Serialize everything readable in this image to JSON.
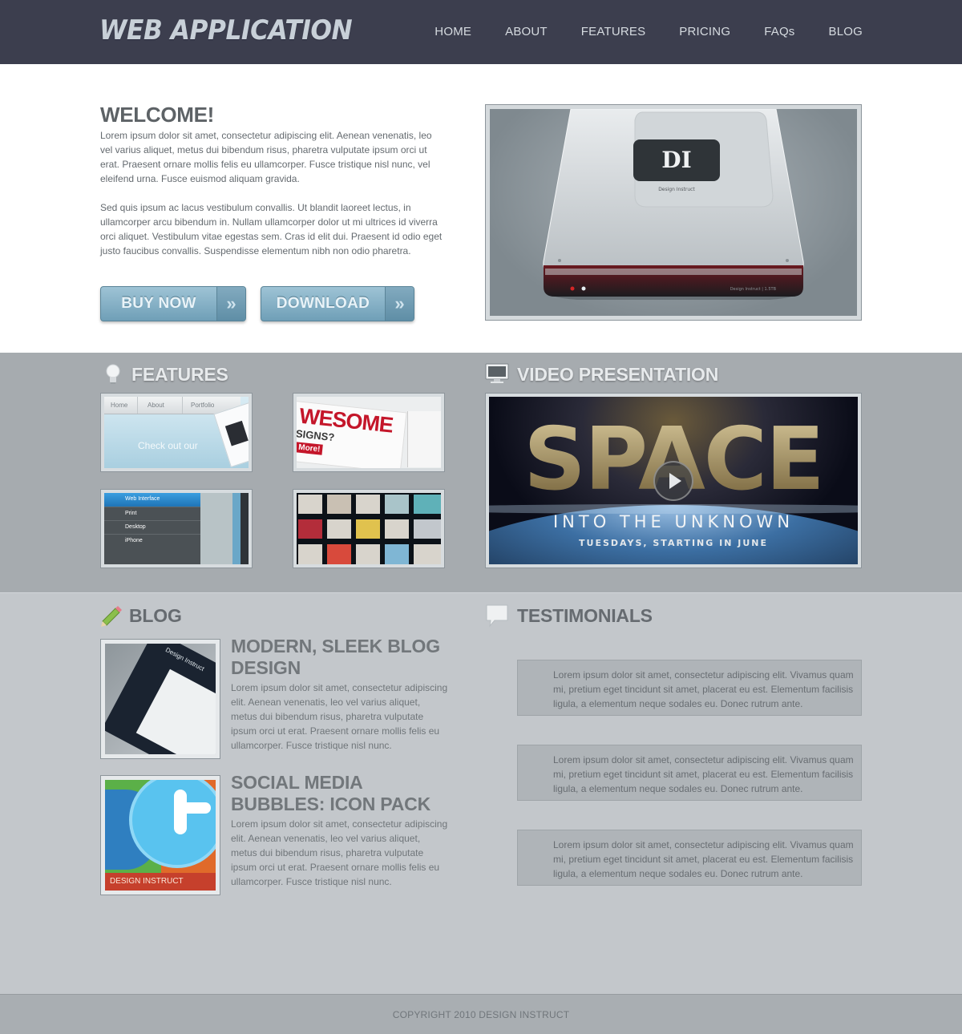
{
  "header": {
    "logo": "WEB APPLICATION",
    "nav": [
      "HOME",
      "ABOUT",
      "FEATURES",
      "PRICING",
      "FAQs",
      "BLOG"
    ]
  },
  "hero": {
    "title": "WELCOME!",
    "paragraphs": [
      "Lorem ipsum dolor sit amet, consectetur adipiscing elit. Aenean venenatis, leo vel varius aliquet, metus dui bibendum risus, pharetra vulputate ipsum orci ut erat. Praesent ornare mollis felis eu ullamcorper. Fusce tristique nisl nunc, vel eleifend urna. Fusce euismod aliquam gravida.",
      "Sed quis ipsum ac lacus vestibulum convallis. Ut blandit laoreet lectus, in ullamcorper arcu bibendum in. Nullam ullamcorper dolor ut mi ultrices id viverra orci aliquet. Vestibulum vitae egestas sem. Cras id elit dui. Praesent id odio eget justo faucibus convallis. Suspendisse elementum nibh non odio pharetra."
    ],
    "buy_label": "BUY NOW",
    "download_label": "DOWNLOAD",
    "arrow": "»",
    "drive_logo": "DI",
    "drive_brand": "Design Instruct",
    "drive_meta": "Design Instruct  |  1.5TB"
  },
  "features": {
    "title": "FEATURES",
    "thumb1": {
      "tabs": [
        "Home",
        "About",
        "Portfolio"
      ],
      "text": "Check out our"
    },
    "thumb2": {
      "big": "WESOME",
      "sub": "SIGNS?",
      "more": "More!"
    },
    "thumb3": {
      "items": [
        "Web Interface",
        "Print",
        "Desktop",
        "iPhone"
      ]
    }
  },
  "video": {
    "title": "VIDEO PRESENTATION",
    "headline": "SPACE",
    "tagline": "INTO THE UNKNOWN",
    "schedule": "TUESDAYS, STARTING IN JUNE"
  },
  "blog": {
    "title": "BLOG",
    "posts": [
      {
        "title": "MODERN, SLEEK BLOG DESIGN",
        "text": "Lorem ipsum dolor sit amet, consectetur adipiscing elit. Aenean venenatis, leo vel varius aliquet, metus dui bibendum risus, pharetra vulputate ipsum orci ut erat. Praesent ornare mollis felis eu ullamcorper. Fusce tristique nisl nunc.",
        "thumb_text": "Design Instruct"
      },
      {
        "title": "SOCIAL MEDIA BUBBLES: ICON PACK",
        "text": "Lorem ipsum dolor sit amet, consectetur adipiscing elit. Aenean venenatis, leo vel varius aliquet, metus dui bibendum risus, pharetra vulputate ipsum orci ut erat. Praesent ornare mollis felis eu ullamcorper. Fusce tristique nisl nunc.",
        "thumb_text": "DESIGN INSTRUCT"
      }
    ]
  },
  "testimonials": {
    "title": "TESTIMONIALS",
    "items": [
      "Lorem ipsum dolor sit amet, consectetur adipiscing elit. Vivamus quam mi, pretium eget tincidunt sit amet, placerat eu est. Elementum facilisis ligula, a elementum neque sodales eu. Donec rutrum ante.",
      "Lorem ipsum dolor sit amet, consectetur adipiscing elit. Vivamus quam mi, pretium eget tincidunt sit amet, placerat eu est. Elementum facilisis ligula, a elementum neque sodales eu. Donec rutrum ante.",
      "Lorem ipsum dolor sit amet, consectetur adipiscing elit. Vivamus quam mi, pretium eget tincidunt sit amet, placerat eu est. Elementum facilisis ligula, a elementum neque sodales eu. Donec rutrum ante."
    ]
  },
  "footer": {
    "copyright": "COPYRIGHT 2010 DESIGN INSTRUCT"
  },
  "icons": {
    "features": "lightbulb-icon",
    "video": "monitor-icon",
    "blog": "pencil-icon",
    "testimonials": "speech-bubble-icon",
    "play": "play-icon"
  },
  "colors": {
    "header_bg": "#3c3e4e",
    "button_blue": "#7fabc1",
    "band_bg": "#a6abaf",
    "page_bg": "#c3c7cb"
  }
}
